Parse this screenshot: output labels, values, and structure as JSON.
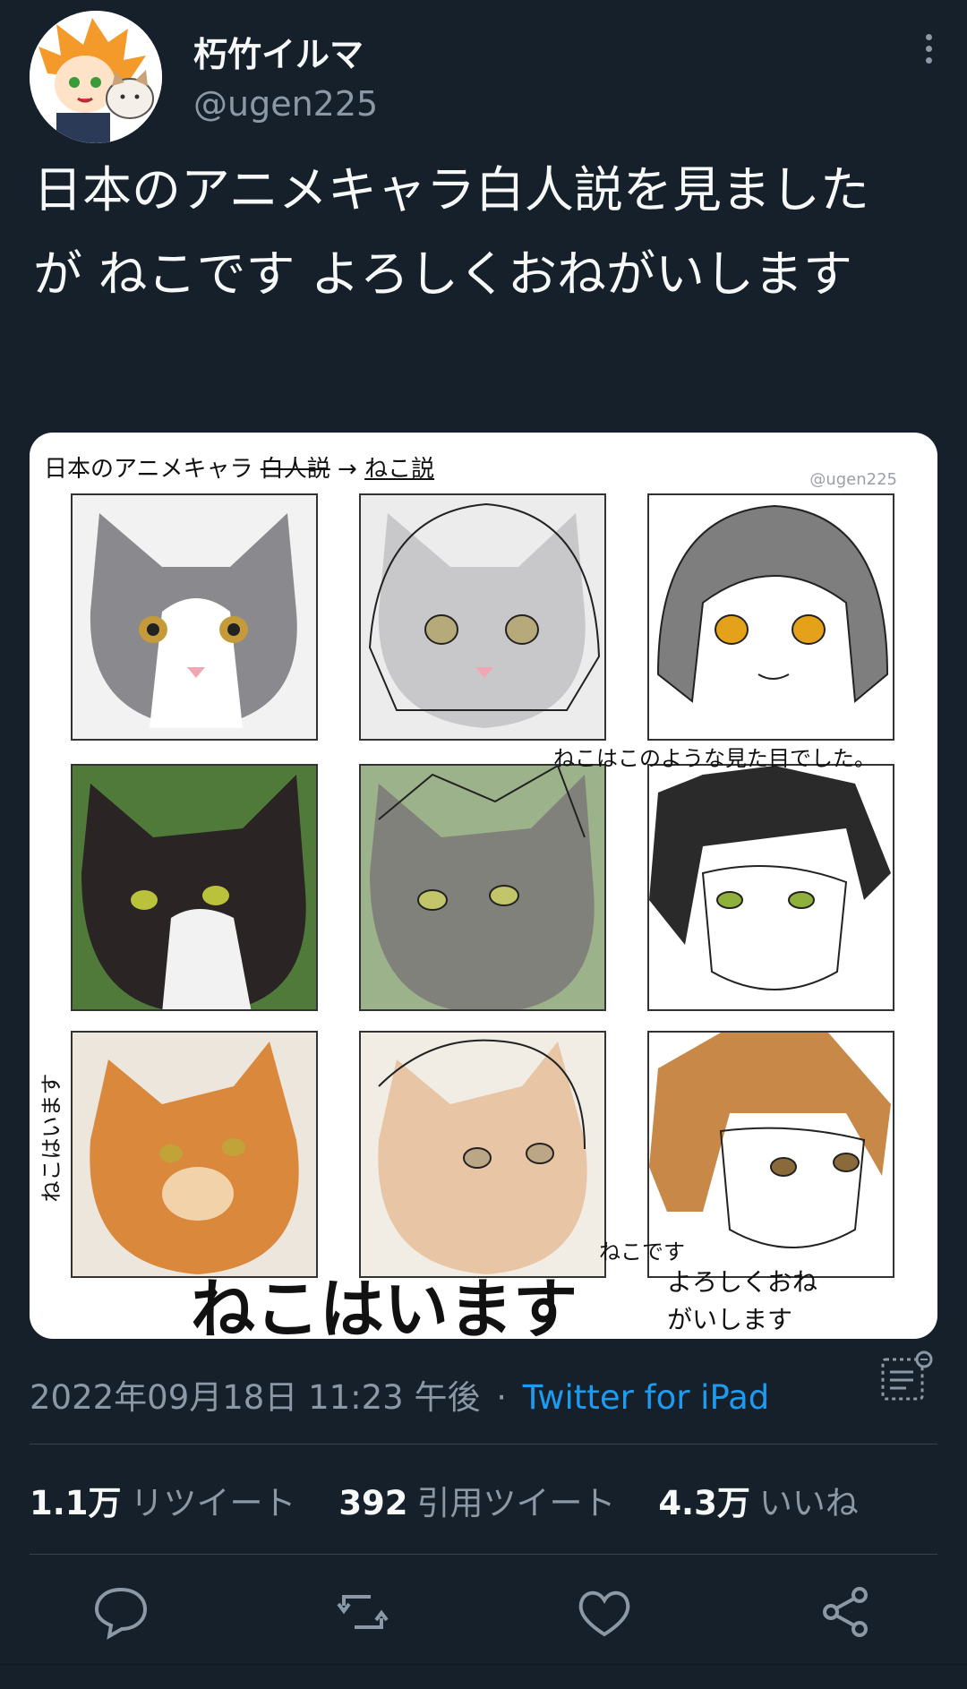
{
  "user": {
    "display_name": "朽竹イルマ",
    "handle": "@ugen225"
  },
  "tweet": {
    "text": "日本のアニメキャラ白人説を見ました が ねこです よろしくおねがいします"
  },
  "media": {
    "title_prefix": "日本のアニメキャラ",
    "title_struck": "白人説",
    "title_arrow": "→",
    "title_new": "ねこ説",
    "watermark": "@ugen225",
    "note_middle": "ねこはこのような見た目でした。",
    "note_left_vertical": "ねこはいます",
    "note_bottom_big": "ねこはいます",
    "note_bottom_small": "ねこです",
    "note_bottom_right": "よろしくおね\nがいします"
  },
  "meta": {
    "timestamp": "2022年09月18日 11:23 午後",
    "separator": "·",
    "source": "Twitter for iPad"
  },
  "stats": {
    "retweets_count": "1.1万",
    "retweets_label": "リツイート",
    "quotes_count": "392",
    "quotes_label": "引用ツイート",
    "likes_count": "4.3万",
    "likes_label": "いいね"
  },
  "icons": {
    "more": "more-vertical-icon",
    "analytics": "analytics-icon",
    "reply": "reply-icon",
    "retweet": "retweet-icon",
    "like": "heart-icon",
    "share": "share-icon"
  },
  "colors": {
    "background": "#15202b",
    "text": "#f7f9f9",
    "secondary": "#8b98a5",
    "accent": "#1d9bf0",
    "divider": "#38444d"
  }
}
